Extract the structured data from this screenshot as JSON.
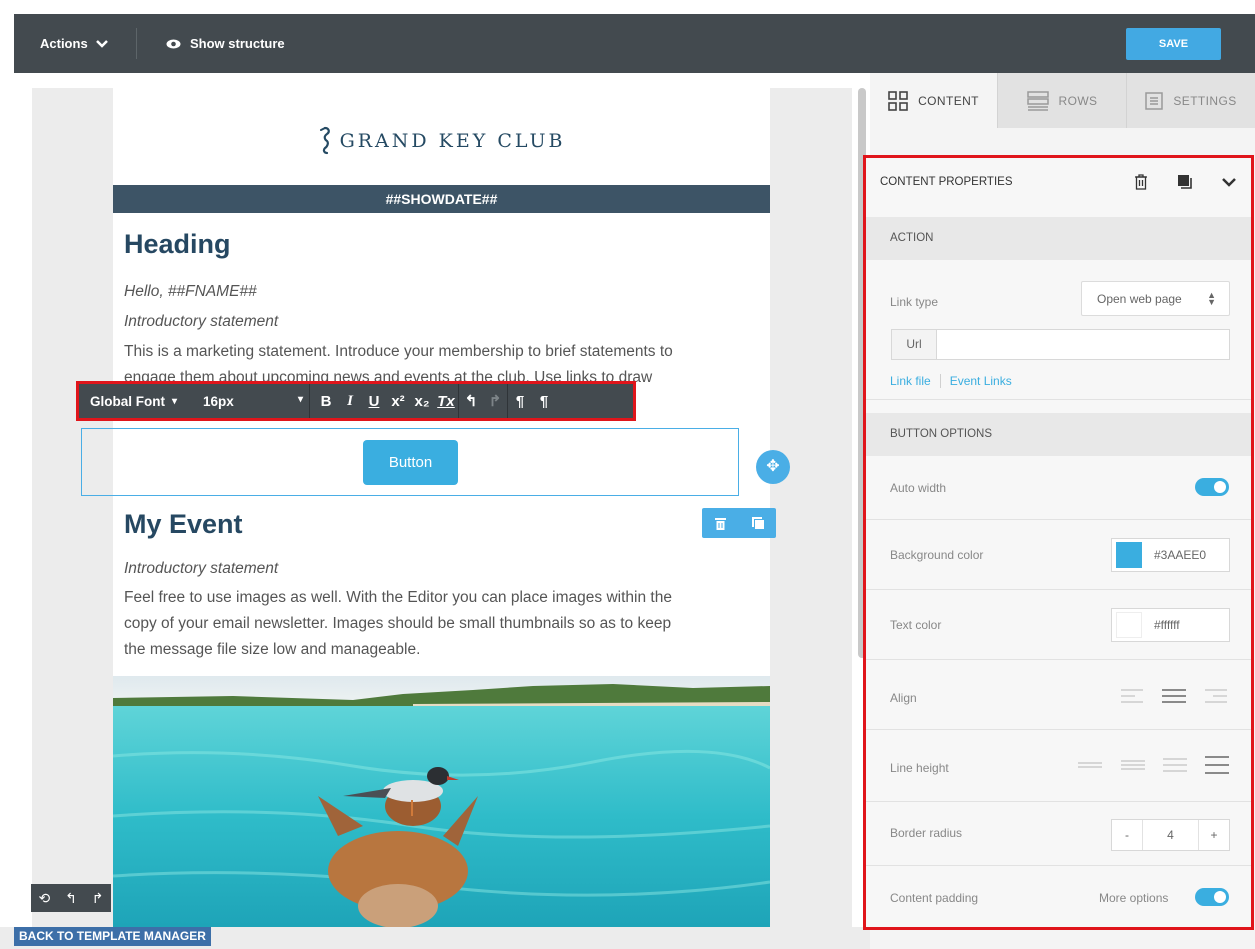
{
  "toolbar": {
    "actions_label": "Actions",
    "structure_label": "Show structure",
    "save_label": "SAVE"
  },
  "email": {
    "logo_text": "GRAND KEY CLUB",
    "date_bar": "##SHOWDATE##",
    "section1": {
      "heading": "Heading",
      "greeting": "Hello, ##FNAME##",
      "intro": "Introductory statement",
      "body_line1": "This is a marketing statement. Introduce your membership to brief statements to",
      "body_line2": "engage them about upcoming news and events at the club. Use links to draw"
    },
    "button_label": "Button",
    "section2": {
      "heading": "My Event",
      "intro": "Introductory statement",
      "body_line1": "Feel free to use images as well. With the Editor you can place images within the",
      "body_line2": "copy of your email newsletter. Images should be small thumbnails so as to keep",
      "body_line3": "the message file size low and manageable."
    }
  },
  "text_toolbar": {
    "font": "Global Font",
    "size": "16px",
    "buttons": [
      "B",
      "I",
      "U",
      "x²",
      "x₂",
      "Tx",
      "undo",
      "redo",
      "ltr",
      "rtl"
    ]
  },
  "footer": {
    "back_label": "BACK TO TEMPLATE MANAGER"
  },
  "panel": {
    "tabs": [
      {
        "label": "CONTENT",
        "icon": "grid-icon",
        "active": true
      },
      {
        "label": "ROWS",
        "icon": "rows-icon",
        "active": false
      },
      {
        "label": "SETTINGS",
        "icon": "settings-icon",
        "active": false
      }
    ],
    "properties_title": "CONTENT PROPERTIES",
    "action_section": "ACTION",
    "link_type_label": "Link type",
    "link_type_value": "Open web page",
    "url_label": "Url",
    "url_value": "",
    "link_file": "Link file",
    "event_links": "Event Links",
    "button_options_section": "BUTTON OPTIONS",
    "auto_width_label": "Auto width",
    "auto_width_on": true,
    "bg_color_label": "Background color",
    "bg_color": "#3AAEE0",
    "text_color_label": "Text color",
    "text_color": "#ffffff",
    "align_label": "Align",
    "line_height_label": "Line height",
    "border_radius_label": "Border radius",
    "border_radius_value": "4",
    "stepper_minus": "-",
    "stepper_plus": "+",
    "content_padding_label": "Content padding",
    "more_options_label": "More options",
    "more_options_on": true
  },
  "colors": {
    "accent": "#3AAEE0",
    "dark_bar": "#434A4F",
    "date_bar": "#3D5466",
    "heading": "#264862",
    "highlight": "#E0151B"
  }
}
